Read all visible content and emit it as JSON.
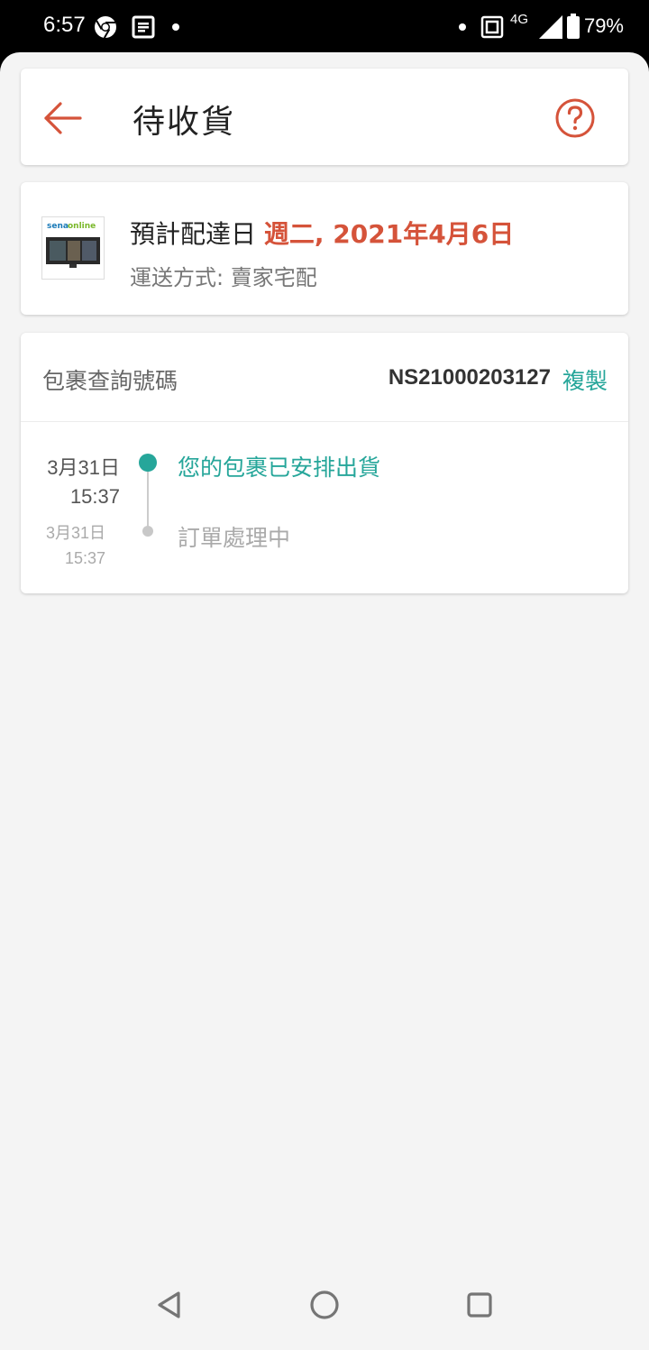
{
  "status_bar": {
    "time": "6:57",
    "network": "4G",
    "battery": "79%",
    "icons": [
      "chrome-icon",
      "news-icon",
      "dot-icon",
      "dot-icon",
      "nfc-icon",
      "signal-icon",
      "battery-icon"
    ]
  },
  "header": {
    "title": "待收貨",
    "back_icon": "arrow-left-icon",
    "help_icon": "question-circle-icon"
  },
  "delivery": {
    "label": "預計配達日",
    "date": "週二, 2021年4月6日",
    "shipping_method": "運送方式: 賣家宅配",
    "thumbnail_logo": "senaonline"
  },
  "tracking": {
    "label": "包裹查詢號碼",
    "number": "NS21000203127",
    "copy_label": "複製",
    "events": [
      {
        "date": "3月31日",
        "time": "15:37",
        "text": "您的包裹已安排出貨",
        "active": true
      },
      {
        "date": "3月31日",
        "time": "15:37",
        "text": "訂單處理中",
        "active": false
      }
    ]
  },
  "colors": {
    "accent": "#d5533a",
    "teal": "#26a69a",
    "background": "#f4f4f4"
  },
  "nav_bar": {
    "icons": [
      "back-triangle-icon",
      "home-circle-icon",
      "recents-square-icon"
    ]
  }
}
